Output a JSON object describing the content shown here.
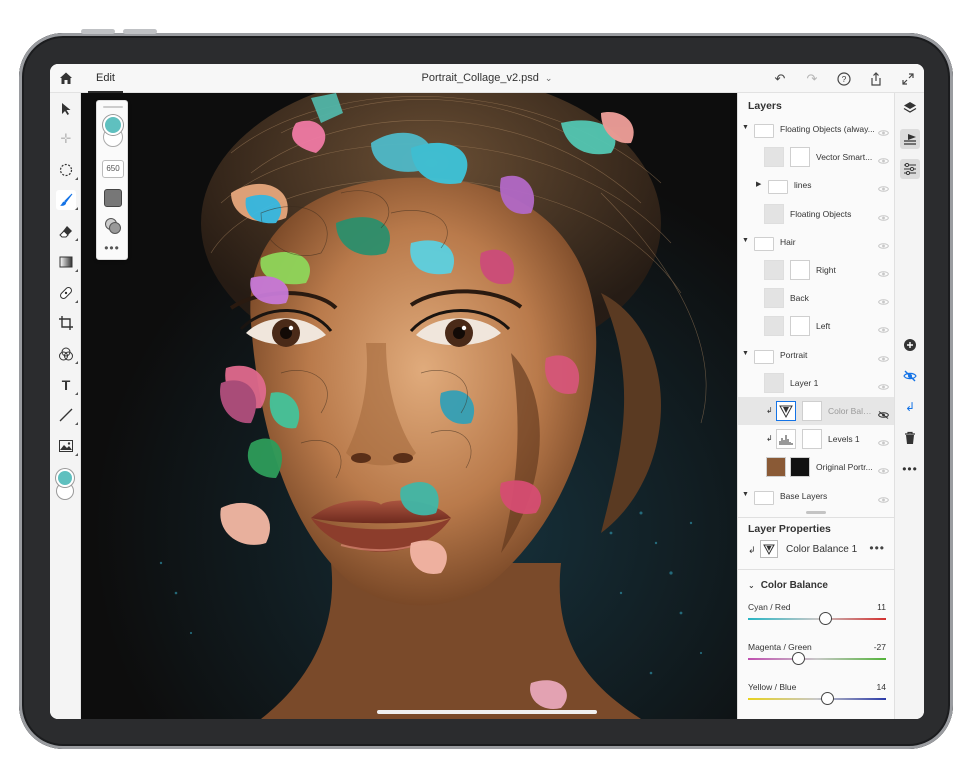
{
  "document": {
    "title": "Portrait_Collage_v2.psd"
  },
  "topbar": {
    "edit_tab": "Edit",
    "icons": [
      "home-icon",
      "undo-icon",
      "redo-icon",
      "help-icon",
      "share-icon",
      "fullscreen-icon"
    ]
  },
  "toolbar": {
    "tools": [
      "move-tool",
      "transform-tool",
      "select-tool",
      "brush-tool",
      "eraser-tool",
      "gradient-tool",
      "healing-tool",
      "crop-tool",
      "fill-tool",
      "type-tool",
      "line-tool",
      "place-image-tool"
    ],
    "foreground_color": "#5fc0bf",
    "background_color": "#ffffff"
  },
  "brush_options": {
    "size": "650",
    "color": "#5fc0bf"
  },
  "layers_panel": {
    "title": "Layers",
    "layers": [
      {
        "name": "Floating Objects (alway...",
        "type": "group",
        "expanded": true,
        "indent": 0
      },
      {
        "name": "Vector Smart...",
        "type": "layer",
        "indent": 1
      },
      {
        "name": "lines",
        "type": "group",
        "expanded": false,
        "indent": 1
      },
      {
        "name": "Floating Objects",
        "type": "layer",
        "indent": 1
      },
      {
        "name": "Hair",
        "type": "group",
        "expanded": true,
        "indent": 0
      },
      {
        "name": "Right",
        "type": "layer",
        "indent": 1
      },
      {
        "name": "Back",
        "type": "layer",
        "indent": 1
      },
      {
        "name": "Left",
        "type": "layer",
        "indent": 1
      },
      {
        "name": "Portrait",
        "type": "group",
        "expanded": true,
        "indent": 0
      },
      {
        "name": "Layer 1",
        "type": "layer",
        "indent": 1
      },
      {
        "name": "Color Bala...",
        "type": "adjustment",
        "indent": 1,
        "selected": true,
        "hidden": true
      },
      {
        "name": "Levels 1",
        "type": "adjustment",
        "indent": 1
      },
      {
        "name": "Original Portr...",
        "type": "layer",
        "indent": 1
      },
      {
        "name": "Base Layers",
        "type": "group",
        "expanded": true,
        "indent": 0
      }
    ]
  },
  "layer_properties": {
    "title": "Layer Properties",
    "layer_name": "Color Balance 1",
    "section": "Color Balance",
    "sliders": [
      {
        "label": "Cyan / Red",
        "value": "11",
        "fraction": 0.555,
        "left_color": "#27b5c4",
        "right_color": "#d3302f"
      },
      {
        "label": "Magenta / Green",
        "value": "-27",
        "fraction": 0.365,
        "left_color": "#c04fb0",
        "right_color": "#53b339"
      },
      {
        "label": "Yellow / Blue",
        "value": "14",
        "fraction": 0.57,
        "left_color": "#e8d21d",
        "right_color": "#2b3aa8"
      }
    ]
  },
  "right_rail": {
    "icons": [
      "layers-icon",
      "layer-properties-icon",
      "adjustments-icon",
      "add-layer-icon",
      "visibility-icon",
      "clip-icon",
      "delete-icon",
      "more-icon"
    ]
  }
}
